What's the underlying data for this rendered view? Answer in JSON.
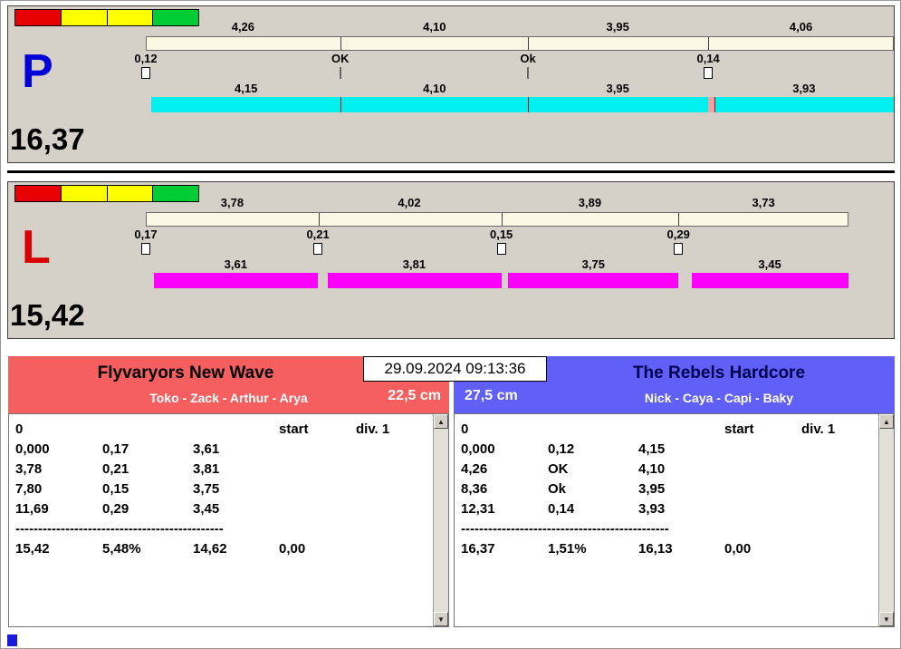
{
  "datetime": "29.09.2024 09:13:36",
  "icons": {
    "up": "▲",
    "down": "▼"
  },
  "colors": {
    "panel_bg": "#d5d1c8",
    "meter": [
      "#e80000",
      "#ffff00",
      "#ffff00",
      "#00cc33"
    ],
    "upper_bar": "#fbf9e6",
    "p_bar": "#00efef",
    "l_bar": "#fb00fb",
    "p_letter": "#0000d8",
    "l_letter": "#d80000",
    "left_header": "#f55f5f",
    "right_header": "#6060f8",
    "left_title": "#000000",
    "right_title": "#000050"
  },
  "p_panel": {
    "label": "P",
    "total": "16,37",
    "upper_values": [
      "4,26",
      "4,10",
      "3,95",
      "4,06"
    ],
    "exchange_values": [
      "0,12",
      "OK",
      "Ok",
      "0,14"
    ],
    "lower_values": [
      "4,15",
      "4,10",
      "3,95",
      "3,93"
    ]
  },
  "l_panel": {
    "label": "L",
    "total": "15,42",
    "upper_values": [
      "3,78",
      "4,02",
      "3,89",
      "3,73"
    ],
    "exchange_values": [
      "0,17",
      "0,21",
      "0,15",
      "0,29"
    ],
    "lower_values": [
      "3,61",
      "3,81",
      "3,75",
      "3,45"
    ]
  },
  "left_team": {
    "name": "Flyvaryors New Wave",
    "members": "Toko - Zack - Arthur - Arya",
    "distance": "22,5 cm",
    "zero": "0",
    "start_label": "start",
    "div_label": "div. 1",
    "splits": [
      [
        "0,000",
        "0,17",
        "3,61"
      ],
      [
        "3,78",
        "0,21",
        "3,81"
      ],
      [
        "7,80",
        "0,15",
        "3,75"
      ],
      [
        "11,69",
        "0,29",
        "3,45"
      ]
    ],
    "divider": "----------------------------------------------",
    "totals": [
      "15,42",
      "5,48%",
      "14,62",
      "0,00"
    ]
  },
  "right_team": {
    "name": "The Rebels Hardcore",
    "members": "Nick - Caya - Capi - Baky",
    "distance": "27,5 cm",
    "zero": "0",
    "start_label": "start",
    "div_label": "div. 1",
    "splits": [
      [
        "0,000",
        "0,12",
        "4,15"
      ],
      [
        "4,26",
        "OK",
        "4,10"
      ],
      [
        "8,36",
        "Ok",
        "3,95"
      ],
      [
        "12,31",
        "0,14",
        "3,93"
      ]
    ],
    "divider": "----------------------------------------------",
    "totals": [
      "16,37",
      "1,51%",
      "16,13",
      "0,00"
    ]
  }
}
